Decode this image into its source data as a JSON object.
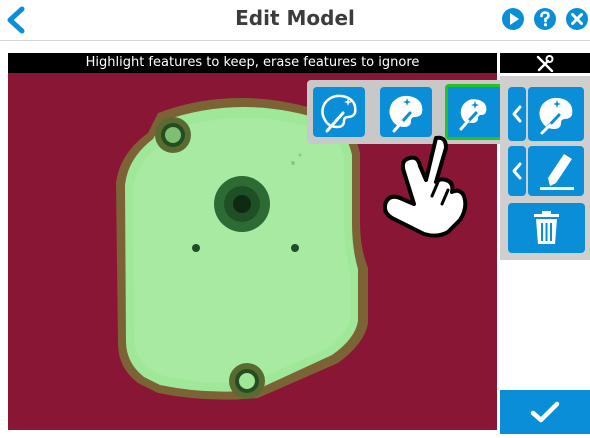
{
  "header": {
    "title": "Edit Model"
  },
  "instruction": "Highlight features to keep, erase features to ignore",
  "tools": {
    "header_icon": "tools-icon",
    "confirm_icon": "checkmark-icon"
  },
  "palette": {
    "options": [
      "brush-wand-outline-icon",
      "brush-wand-filled-icon",
      "brush-wand-small-icon"
    ],
    "selected_index": 2
  },
  "colors": {
    "accent": "#0a8ed8",
    "selected_border": "#22c422",
    "background_surface": "#8a1636",
    "highlight": "#9fe89a"
  }
}
